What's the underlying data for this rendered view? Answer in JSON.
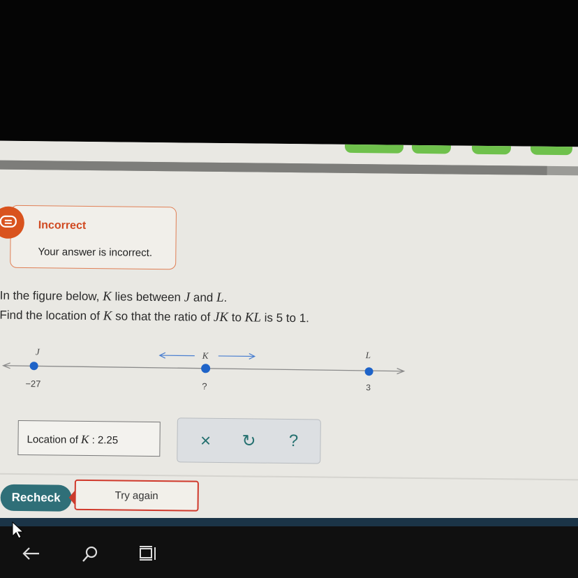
{
  "feedback": {
    "title": "Incorrect",
    "message": "Your answer is incorrect."
  },
  "question": {
    "line1": [
      "In the figure below, ",
      "K",
      " lies between ",
      "J",
      " and ",
      "L",
      "."
    ],
    "line2": [
      "Find the location of ",
      "K",
      " so that the ratio of ",
      "JK",
      " to ",
      "KL",
      " is 5 to 1."
    ]
  },
  "number_line": {
    "points": [
      {
        "label": "J",
        "value_label": "−27"
      },
      {
        "label": "K",
        "value_label": "?"
      },
      {
        "label": "L",
        "value_label": "3"
      }
    ]
  },
  "answer": {
    "prefix": "Location of ",
    "variable": "K",
    "separator": " : ",
    "value": "2.25"
  },
  "tools": {
    "clear_symbol": "×",
    "undo_symbol": "↻",
    "help_symbol": "?"
  },
  "buttons": {
    "recheck": "Recheck",
    "try_again": "Try again"
  },
  "colors": {
    "accent": "#2f6f78",
    "error": "#d04a22",
    "point": "#1e63c8",
    "tab_green": "#6fc14c"
  },
  "taskbar": {
    "icons": [
      "back-arrow-icon",
      "search-icon",
      "task-view-icon"
    ]
  }
}
